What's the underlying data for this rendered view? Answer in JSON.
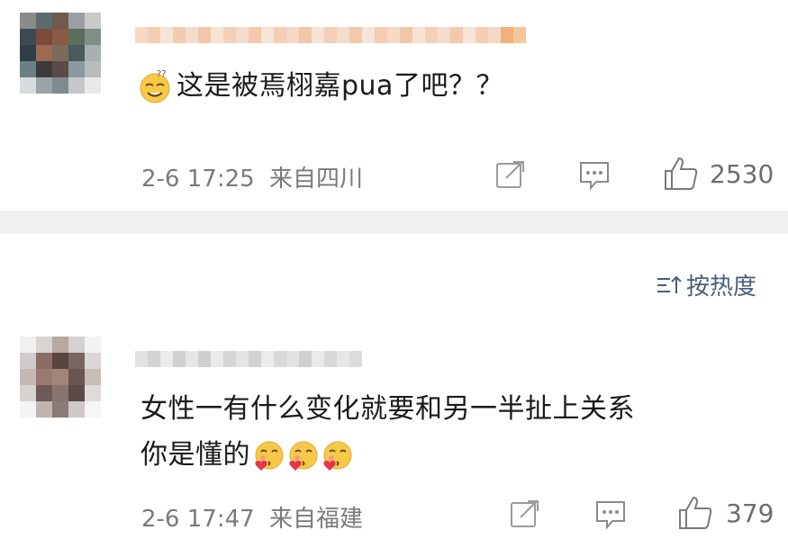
{
  "comments": [
    {
      "text_line1": "这是被焉栩嘉pua了吧？？",
      "time": "2-6 17:25",
      "location": "来自四川",
      "likes": "2530"
    },
    {
      "text_line1": "女性一有什么变化就要和另一半扯上关系",
      "text_line2": "你是懂的",
      "time": "2-6 17:47",
      "location": "来自福建",
      "likes": "379"
    }
  ],
  "sort": {
    "label": "按热度"
  },
  "colors": {
    "divider": "#f0f0f0",
    "meta": "#7a7a7a",
    "sort": "#4a5f7a"
  },
  "icons": [
    "thinking-smile-emoji",
    "share-icon",
    "comment-icon",
    "like-icon",
    "sort-icon",
    "heart-kiss-emoji"
  ]
}
